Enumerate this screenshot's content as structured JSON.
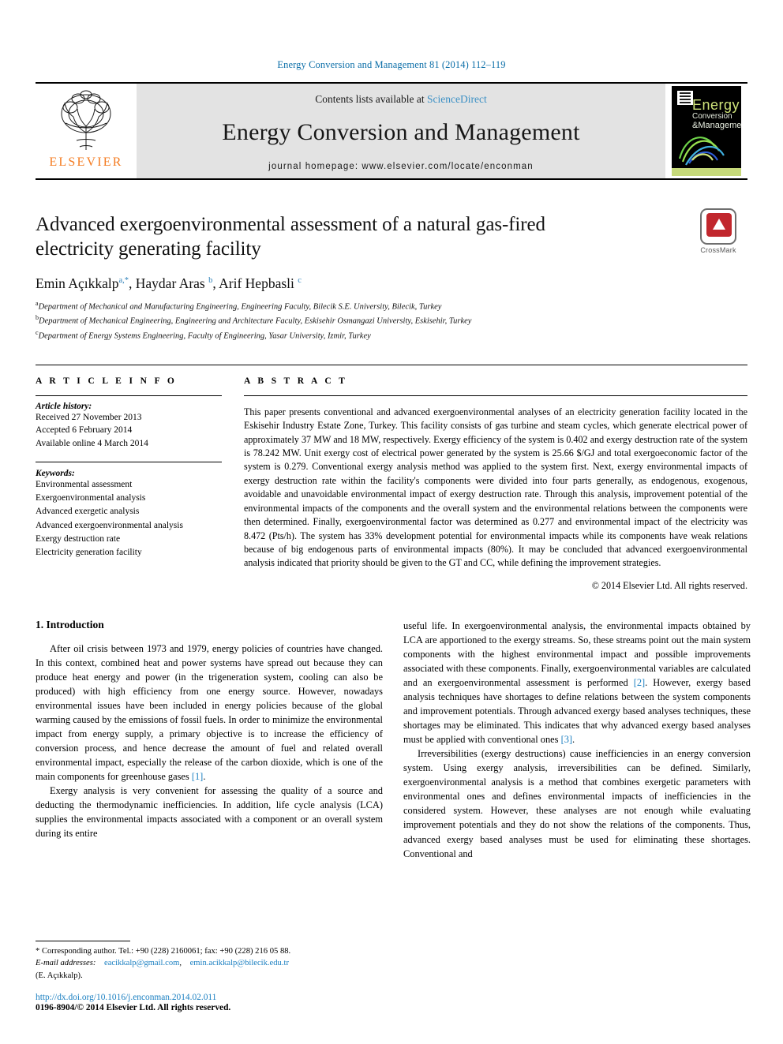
{
  "running_head": "Energy Conversion and Management 81 (2014) 112–119",
  "masthead": {
    "publisher": "ELSEVIER",
    "contents_prefix": "Contents lists available at ",
    "sciencedirect": "ScienceDirect",
    "journal_title": "Energy Conversion and Management",
    "homepage": "journal homepage: www.elsevier.com/locate/enconman",
    "cover": {
      "line1": "Energy",
      "line2": "Conversion",
      "line3": "&Management"
    }
  },
  "article": {
    "title": "Advanced exergoenvironmental assessment of a natural gas-fired electricity generating facility",
    "crossmark_label": "CrossMark",
    "authors_html": "Emin Açıkkalp<sup>a,*</sup>, Haydar Aras <sup>b</sup>, Arif Hepbasli <sup>c</sup>",
    "affiliations": [
      "Department of Mechanical and Manufacturing Engineering, Engineering Faculty, Bilecik S.E. University, Bilecik, Turkey",
      "Department of Mechanical Engineering, Engineering and Architecture Faculty, Eskisehir Osmangazi University, Eskisehir, Turkey",
      "Department of Energy Systems Engineering, Faculty of Engineering, Yasar University, Izmir, Turkey"
    ],
    "affiliation_marks": [
      "a",
      "b",
      "c"
    ]
  },
  "article_info": {
    "heading": "A R T I C L E   I N F O",
    "history_label": "Article history:",
    "history": [
      "Received 27 November 2013",
      "Accepted 6 February 2014",
      "Available online 4 March 2014"
    ],
    "keywords_label": "Keywords:",
    "keywords": [
      "Environmental assessment",
      "Exergoenvironmental analysis",
      "Advanced exergetic analysis",
      "Advanced exergoenvironmental analysis",
      "Exergy destruction rate",
      "Electricity generation facility"
    ]
  },
  "abstract": {
    "heading": "A B S T R A C T",
    "text": "This paper presents conventional and advanced exergoenvironmental analyses of an electricity generation facility located in the Eskisehir Industry Estate Zone, Turkey. This facility consists of gas turbine and steam cycles, which generate electrical power of approximately 37 MW and 18 MW, respectively. Exergy efficiency of the system is 0.402 and exergy destruction rate of the system is 78.242 MW. Unit exergy cost of electrical power generated by the system is 25.66 $/GJ and total exergoeconomic factor of the system is 0.279. Conventional exergy analysis method was applied to the system first. Next, exergy environmental impacts of exergy destruction rate within the facility's components were divided into four parts generally, as endogenous, exogenous, avoidable and unavoidable environmental impact of exergy destruction rate. Through this analysis, improvement potential of the environmental impacts of the components and the overall system and the environmental relations between the components were then determined. Finally, exergoenvironmental factor was determined as 0.277 and environmental impact of the electricity was 8.472 (Pts/h). The system has 33% development potential for environmental impacts while its components have weak relations because of big endogenous parts of environmental impacts (80%). It may be concluded that advanced exergoenvironmental analysis indicated that priority should be given to the GT and CC, while defining the improvement strategies.",
    "copyright": "© 2014 Elsevier Ltd. All rights reserved."
  },
  "body": {
    "section_number_title": "1. Introduction",
    "left_paragraphs": [
      "After oil crisis between 1973 and 1979, energy policies of countries have changed. In this context, combined heat and power systems have spread out because they can produce heat energy and power (in the trigeneration system, cooling can also be produced) with high efficiency from one energy source. However, nowadays environmental issues have been included in energy policies because of the global warming caused by the emissions of fossil fuels. In order to minimize the environmental impact from energy supply, a primary objective is to increase the efficiency of conversion process, and hence decrease the amount of fuel and related overall environmental impact, especially the release of the carbon dioxide, which is one of the main components for greenhouse gases ",
      "Exergy analysis is very convenient for assessing the quality of a source and deducting the thermodynamic inefficiencies. In addition, life cycle analysis (LCA) supplies the environmental impacts associated with a component or an overall system during its entire"
    ],
    "left_ref_1": "[1]",
    "left_ref_1_tail": ".",
    "right_paragraphs": [
      "useful life. In exergoenvironmental analysis, the environmental impacts obtained by LCA are apportioned to the exergy streams. So, these streams point out the main system components with the highest environmental impact and possible improvements associated with these components. Finally, exergoenvironmental variables are calculated and an exergoenvironmental assessment is performed ",
      "Irreversibilities (exergy destructions) cause inefficiencies in an energy conversion system. Using exergy analysis, irreversibilities can be defined. Similarly, exergoenvironmental analysis is a method that combines exergetic parameters with environmental ones and defines environmental impacts of inefficiencies in the considered system. However, these analyses are not enough while evaluating improvement potentials and they do not show the relations of the components. Thus, advanced exergy based analyses must be used for eliminating these shortages. Conventional and"
    ],
    "right_ref_2": "[2]",
    "right_p1_tail": ". However, exergy based analysis techniques have shortages to define relations between the system components and improvement potentials. Through advanced exergy based analyses techniques, these shortages may be eliminated. This indicates that why advanced exergy based analyses must be applied with conventional ones ",
    "right_ref_3": "[3]",
    "right_p1_tail2": "."
  },
  "footnote": {
    "corresponding": "* Corresponding author. Tel.: +90 (228) 2160061; fax: +90 (228) 216 05 88.",
    "email_label": "E-mail addresses:",
    "email1": "eacikkalp@gmail.com",
    "email_sep": ",",
    "email2": "emin.acikkalp@bilecik.edu.tr",
    "email_owner": "(E. Açıkkalp).",
    "doi": "http://dx.doi.org/10.1016/j.enconman.2014.02.011",
    "issn": "0196-8904/© 2014 Elsevier Ltd. All rights reserved."
  },
  "colors": {
    "link": "#1a7fc1",
    "running_head": "#0b6ea8",
    "elsevier_orange": "#f47b20",
    "masthead_grey": "#e3e3e3"
  }
}
